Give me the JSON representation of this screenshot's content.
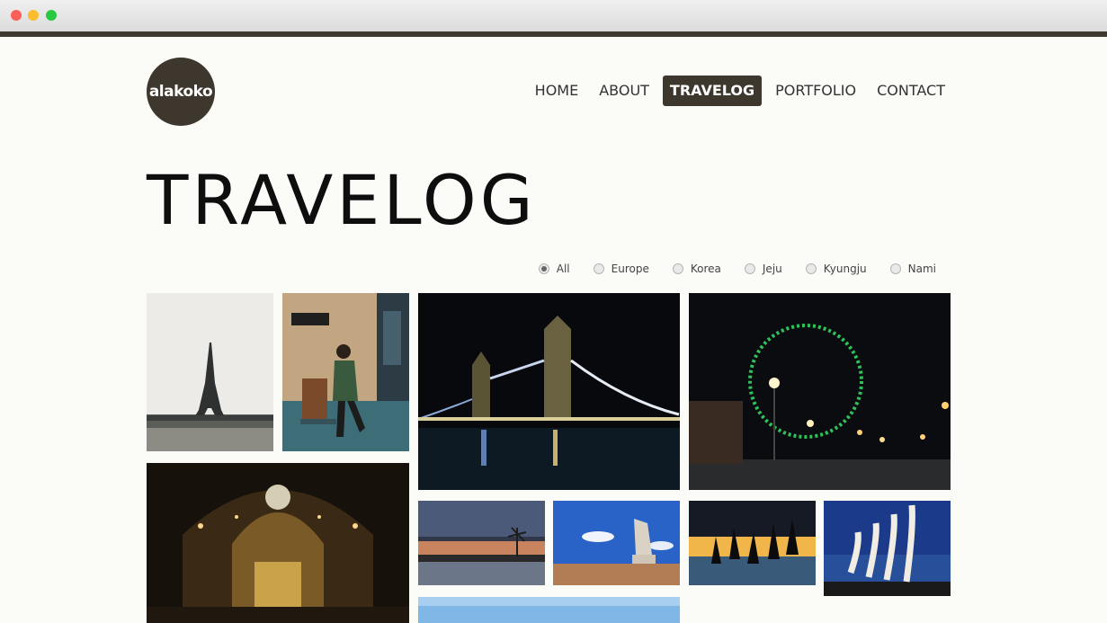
{
  "logo": {
    "text": "alakoko"
  },
  "nav": {
    "items": [
      {
        "label": "HOME",
        "active": false
      },
      {
        "label": "ABOUT",
        "active": false
      },
      {
        "label": "TRAVELOG",
        "active": true
      },
      {
        "label": "PORTFOLIO",
        "active": false
      },
      {
        "label": "CONTACT",
        "active": false
      }
    ]
  },
  "page": {
    "title": "TRAVELOG"
  },
  "filters": {
    "selected": "All",
    "options": [
      "All",
      "Europe",
      "Korea",
      "Jeju",
      "Kyungju",
      "Nami"
    ]
  },
  "colors": {
    "brand": "#3d372d",
    "background": "#fbfbf8",
    "chrome_bar": "#3f3a30"
  },
  "gallery": {
    "photos": [
      {
        "name": "eiffel-tower-photo"
      },
      {
        "name": "platform-nine-three-quarters-photo"
      },
      {
        "name": "tower-bridge-night-photo"
      },
      {
        "name": "london-eye-night-photo"
      },
      {
        "name": "cathedral-interior-photo"
      },
      {
        "name": "sunset-skyline-photo"
      },
      {
        "name": "angel-statue-photo"
      },
      {
        "name": "jumping-silhouettes-photo"
      },
      {
        "name": "pier-sculptures-photo"
      },
      {
        "name": "blue-sky-photo"
      }
    ]
  }
}
